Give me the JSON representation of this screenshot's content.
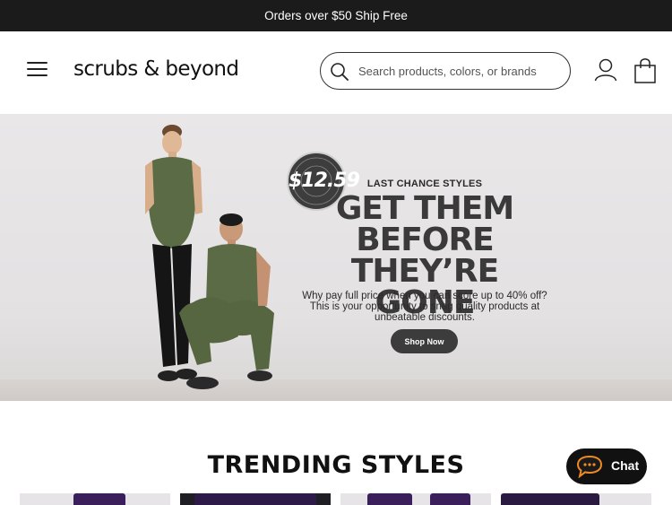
{
  "promo": {
    "text": "Orders over $50 Ship Free"
  },
  "header": {
    "logo": "scrubs & beyond",
    "search_placeholder": "Search products, colors, or brands"
  },
  "hero": {
    "badge": {
      "ring_text": "DEALS STARTING FROM",
      "price": "$12.59"
    },
    "kicker": "LAST CHANCE STYLES",
    "title_lines": [
      "GET THEM",
      "BEFORE THEY’RE",
      "GONE"
    ],
    "body_lines": [
      "Why pay full price when you can score up to 40% off?",
      "This is your opportunity to snag quality products at",
      "unbeatable discounts."
    ],
    "cta": "Shop Now"
  },
  "trending": {
    "title": "TRENDING STYLES"
  },
  "chat": {
    "label": "Chat"
  },
  "colors": {
    "promo_bg": "#1b1b1b",
    "scrub_green": "#5b6b45",
    "cta_bg": "#3c3c3c",
    "tile_purple": "#3a1f5a"
  }
}
